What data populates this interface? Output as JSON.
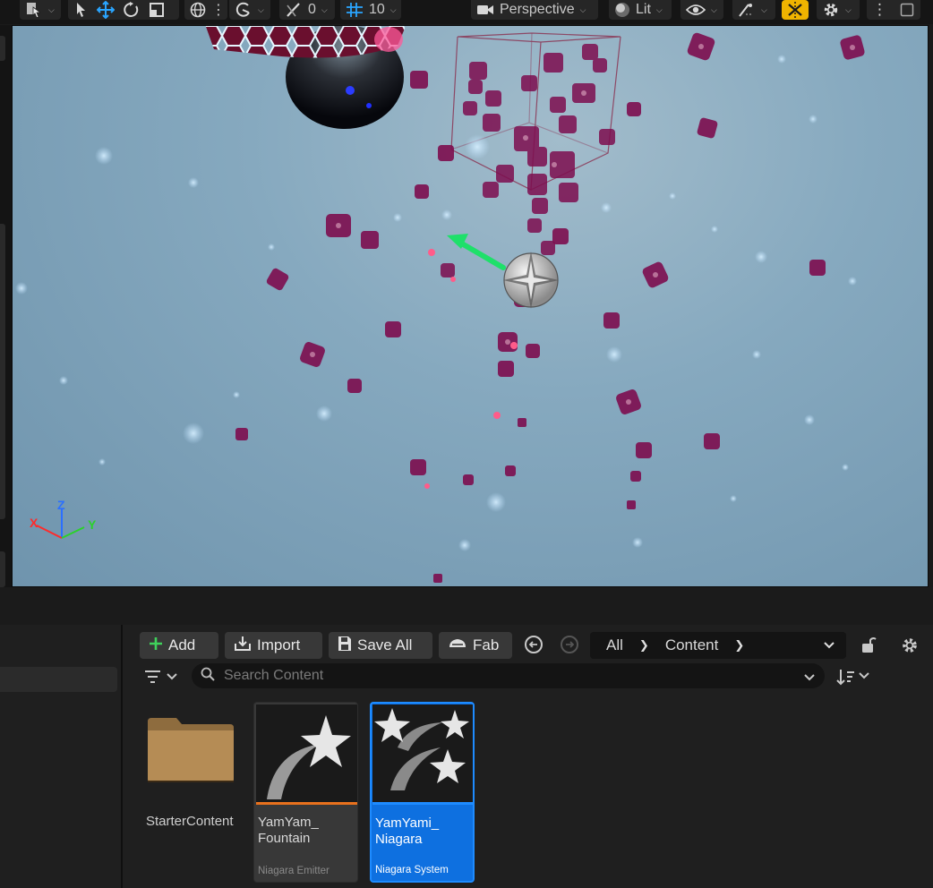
{
  "toolbar": {
    "translate_snap_value": "0",
    "grid_snap_value": "10",
    "view_mode_label": "Perspective",
    "lighting_mode_label": "Lit",
    "icons": [
      "select-mode-icon",
      "select-arrow-icon",
      "translate-icon",
      "rotate-icon",
      "scale-icon",
      "world-icon",
      "rotation-snap-icon",
      "angle-snap-icon",
      "grid-snap-icon",
      "camera-icon",
      "lit-sphere-icon",
      "eye-icon",
      "realtime-icon",
      "snap-toggle-icon",
      "settings-gear-icon",
      "more-icon",
      "maximize-icon"
    ],
    "snap_toggle_color": "#f0b400"
  },
  "viewport": {
    "axis": {
      "x": "X",
      "y": "Y",
      "z": "Z"
    },
    "background_color": "#7fa3ba"
  },
  "content_browser": {
    "add_label": "Add",
    "import_label": "Import",
    "save_all_label": "Save All",
    "fab_label": "Fab",
    "breadcrumb": [
      "All",
      "Content"
    ],
    "search_placeholder": "Search Content",
    "assets": [
      {
        "name": "StarterContent",
        "type": ""
      },
      {
        "name": "YamYam_\nFountain",
        "type": "Niagara Emitter",
        "accent": "#e8711d"
      },
      {
        "name": "YamYami_\nNiagara",
        "type": "Niagara System",
        "accent": "#1e8bff"
      }
    ],
    "selection_color": "#0e70e0"
  }
}
